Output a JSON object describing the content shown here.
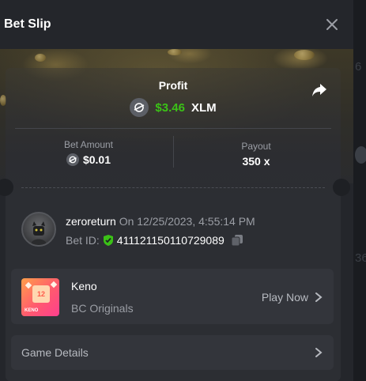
{
  "dialog": {
    "title": "Bet Slip"
  },
  "profit": {
    "label": "Profit",
    "value": "$3.46",
    "currency": "XLM"
  },
  "stats": {
    "bet_amount_label": "Bet Amount",
    "bet_amount_value": "$0.01",
    "payout_label": "Payout",
    "payout_value": "350 x"
  },
  "player": {
    "name": "zeroreturn",
    "date": "On 12/25/2023, 4:55:14 PM",
    "bet_id_label": "Bet ID:",
    "bet_id_value": "411121150110729089"
  },
  "game": {
    "name": "Keno",
    "provider": "BC Originals",
    "action": "Play Now",
    "thumb_number": "12",
    "thumb_label": "KENO"
  },
  "details": {
    "label": "Game Details"
  },
  "background": {
    "ghost_top": "6",
    "ghost_bottom": "36"
  },
  "colors": {
    "accent_green": "#3bc117",
    "panel": "#24262b",
    "card": "#2c2e33",
    "row": "#33353b"
  },
  "icons": [
    "close-icon",
    "share-icon",
    "xlm-icon",
    "verified-shield-icon",
    "copy-icon",
    "chevron-right-icon"
  ]
}
